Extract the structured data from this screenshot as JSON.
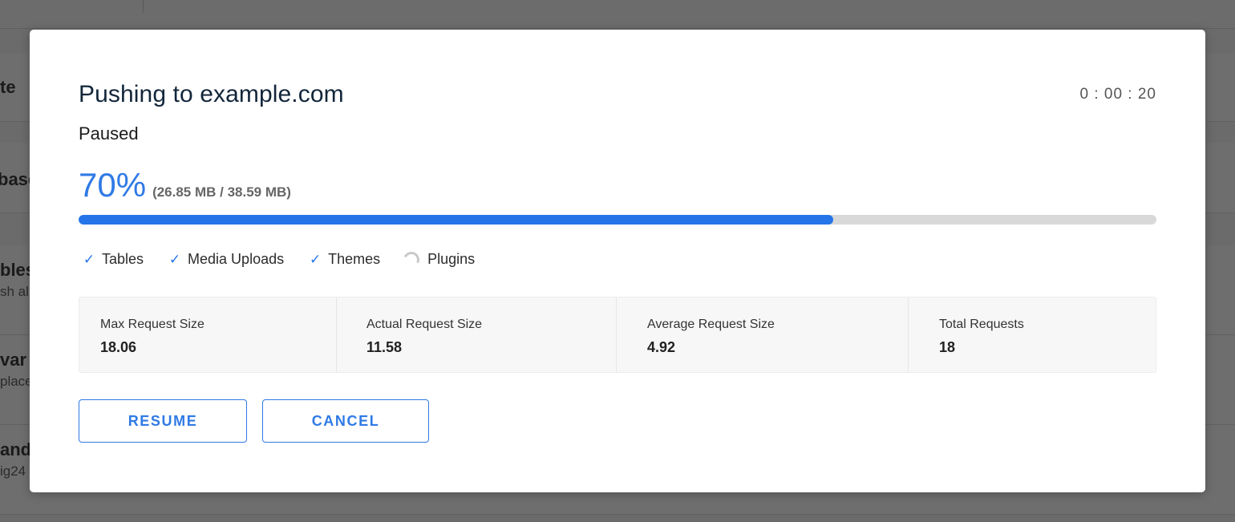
{
  "background": {
    "fragments": [
      {
        "text": "te",
        "style": "heading"
      },
      {
        "text": "base",
        "style": "heading"
      },
      {
        "text": "bles",
        "style": "heading"
      },
      {
        "text": "sh al",
        "style": "sub"
      },
      {
        "text": "var",
        "style": "heading"
      },
      {
        "text": "place",
        "style": "sub"
      },
      {
        "text": "and",
        "style": "heading"
      },
      {
        "text": "ig24",
        "style": "sub"
      }
    ]
  },
  "modal": {
    "title": "Pushing to example.com",
    "timer": "0 : 00 : 20",
    "status": "Paused",
    "progress": {
      "percent_label": "70%",
      "percent_value": 70,
      "size_detail": "(26.85 MB / 38.59 MB)"
    },
    "stages": [
      {
        "label": "Tables",
        "state": "done",
        "icon": "check-icon"
      },
      {
        "label": "Media Uploads",
        "state": "done",
        "icon": "check-icon"
      },
      {
        "label": "Themes",
        "state": "done",
        "icon": "check-icon"
      },
      {
        "label": "Plugins",
        "state": "in-progress",
        "icon": "spinner-icon"
      }
    ],
    "stats": [
      {
        "label": "Max Request Size",
        "value": "18.06"
      },
      {
        "label": "Actual Request Size",
        "value": "11.58"
      },
      {
        "label": "Average Request Size",
        "value": "4.92"
      },
      {
        "label": "Total Requests",
        "value": "18"
      }
    ],
    "buttons": {
      "resume": "RESUME",
      "cancel": "CANCEL"
    }
  },
  "colors": {
    "accent": "#2f7ae5",
    "progress_fill": "#2575e8",
    "progress_track": "#d9d9d9",
    "title_text": "#12263a",
    "overlay": "#6b6b6b"
  }
}
